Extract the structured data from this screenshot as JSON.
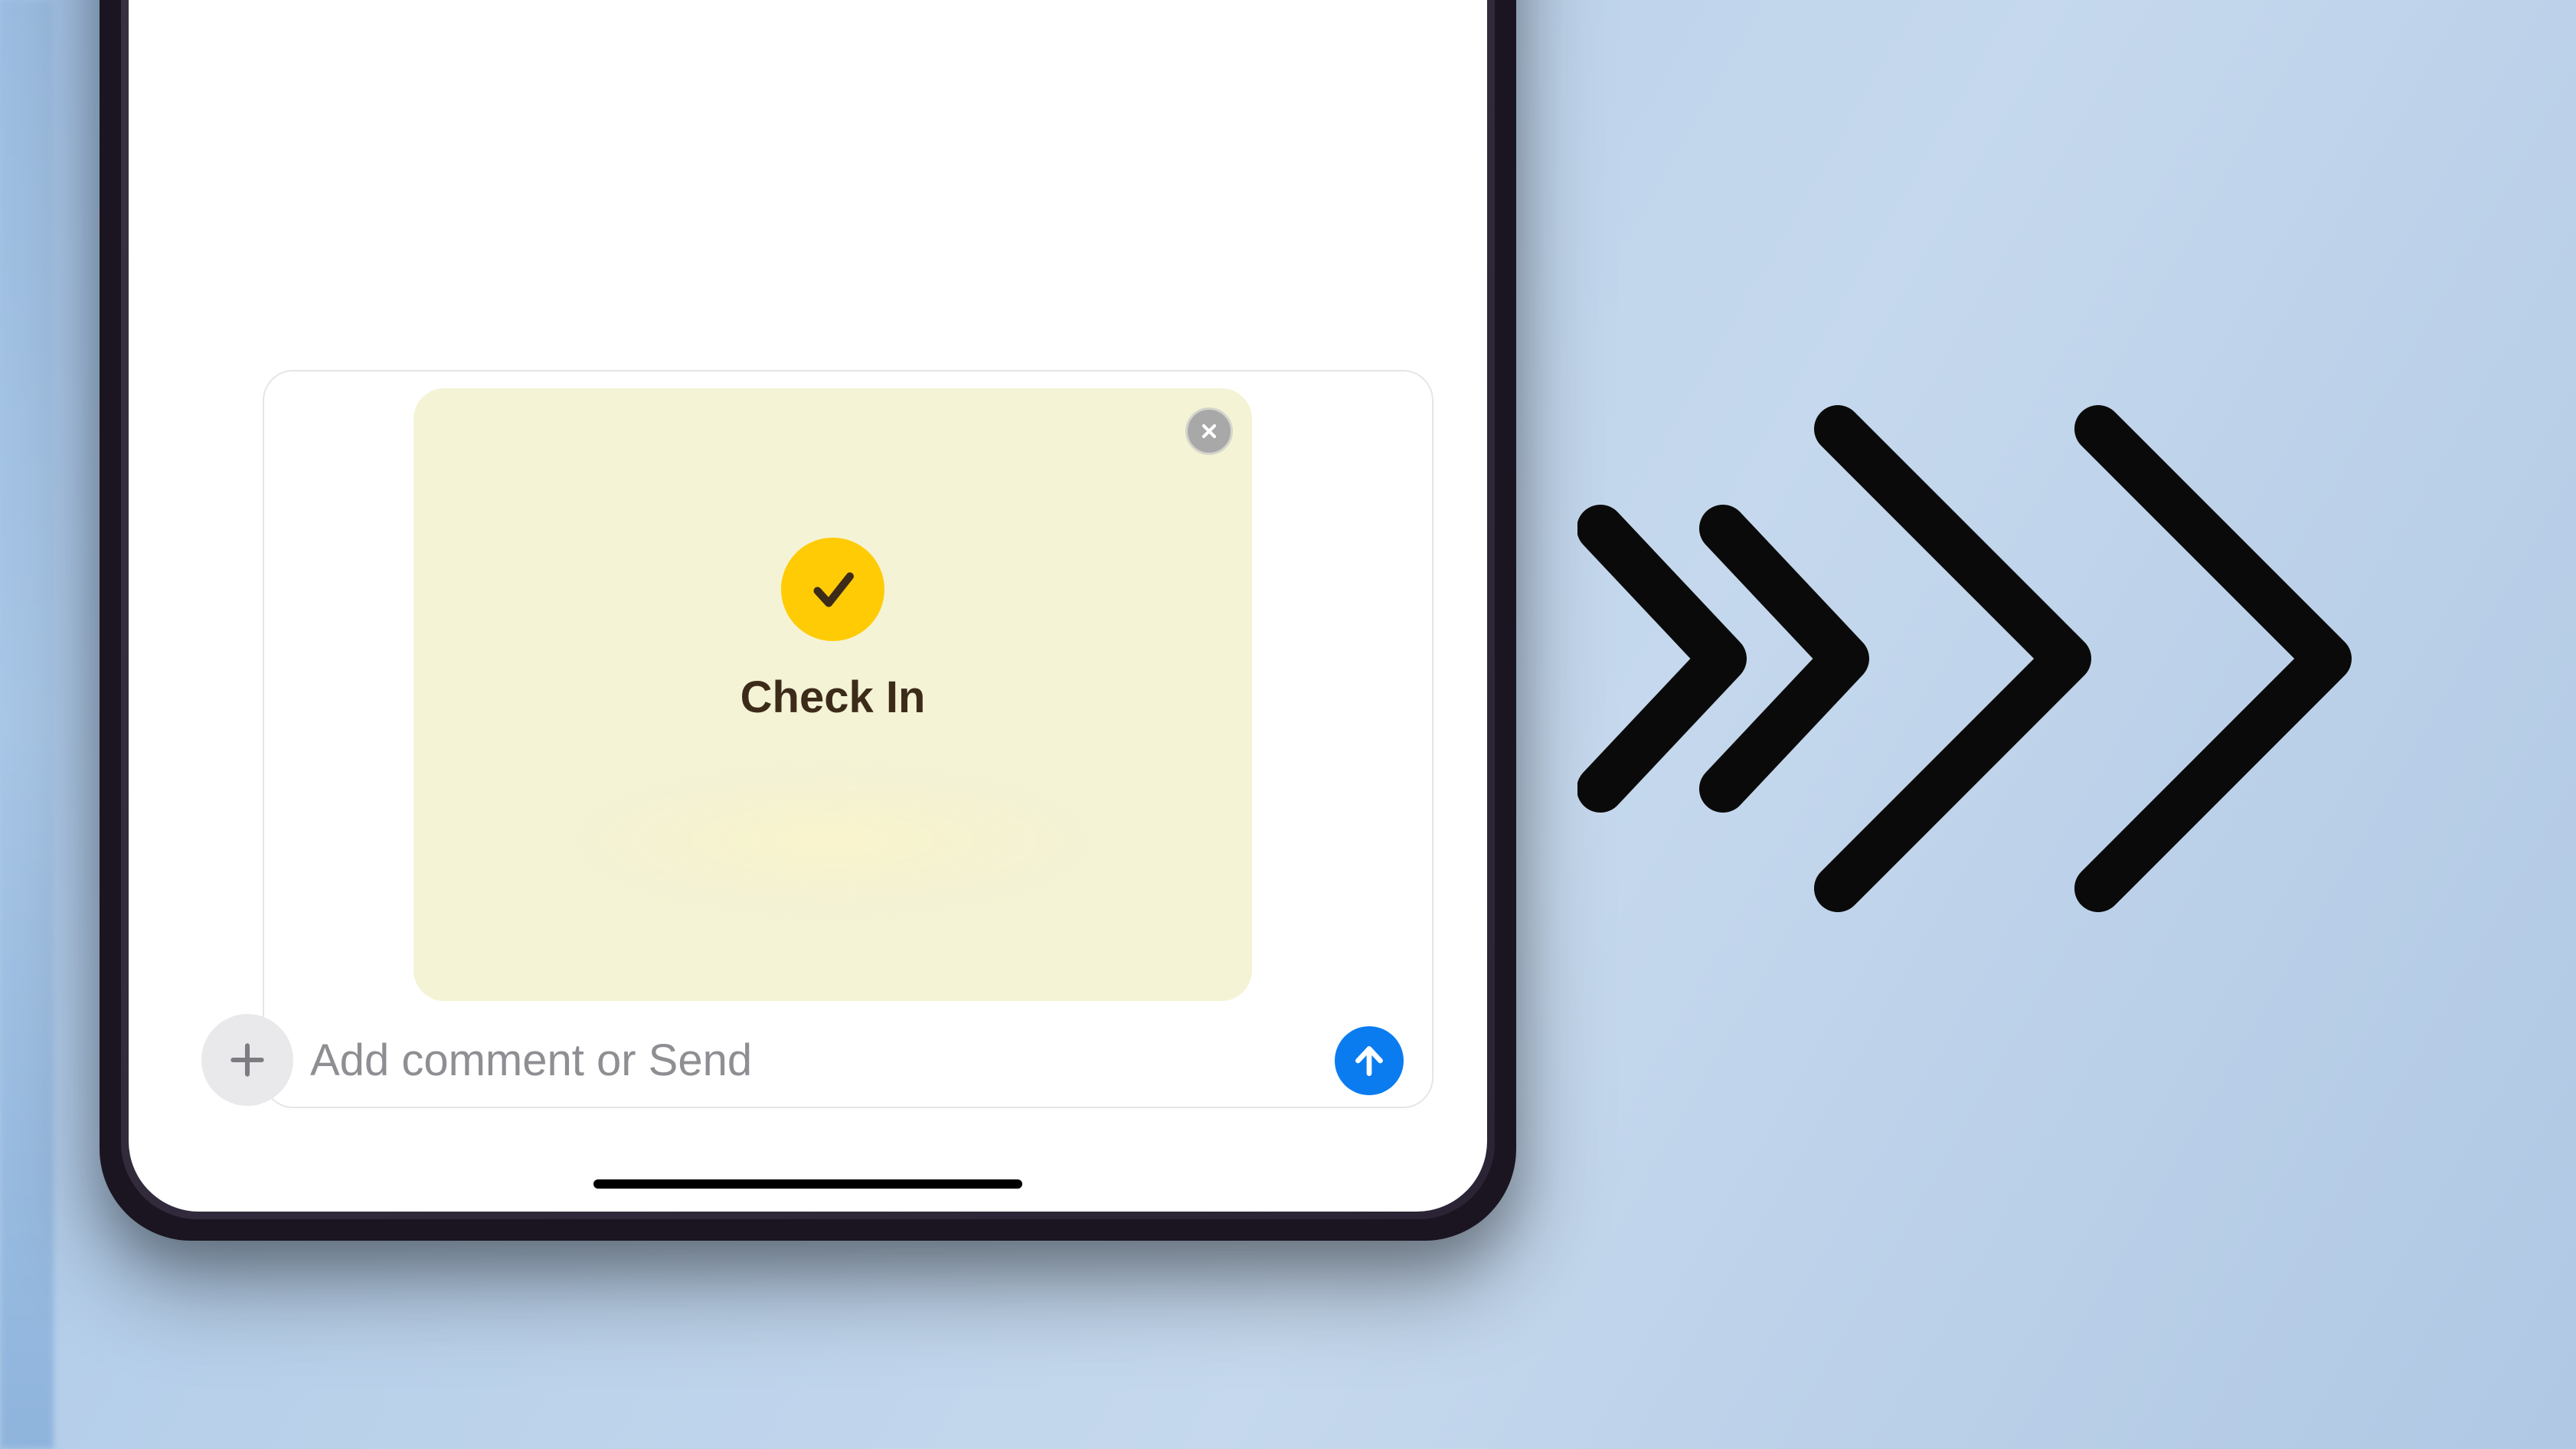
{
  "card": {
    "title": "Check In"
  },
  "composer": {
    "placeholder": "Add comment or Send"
  }
}
